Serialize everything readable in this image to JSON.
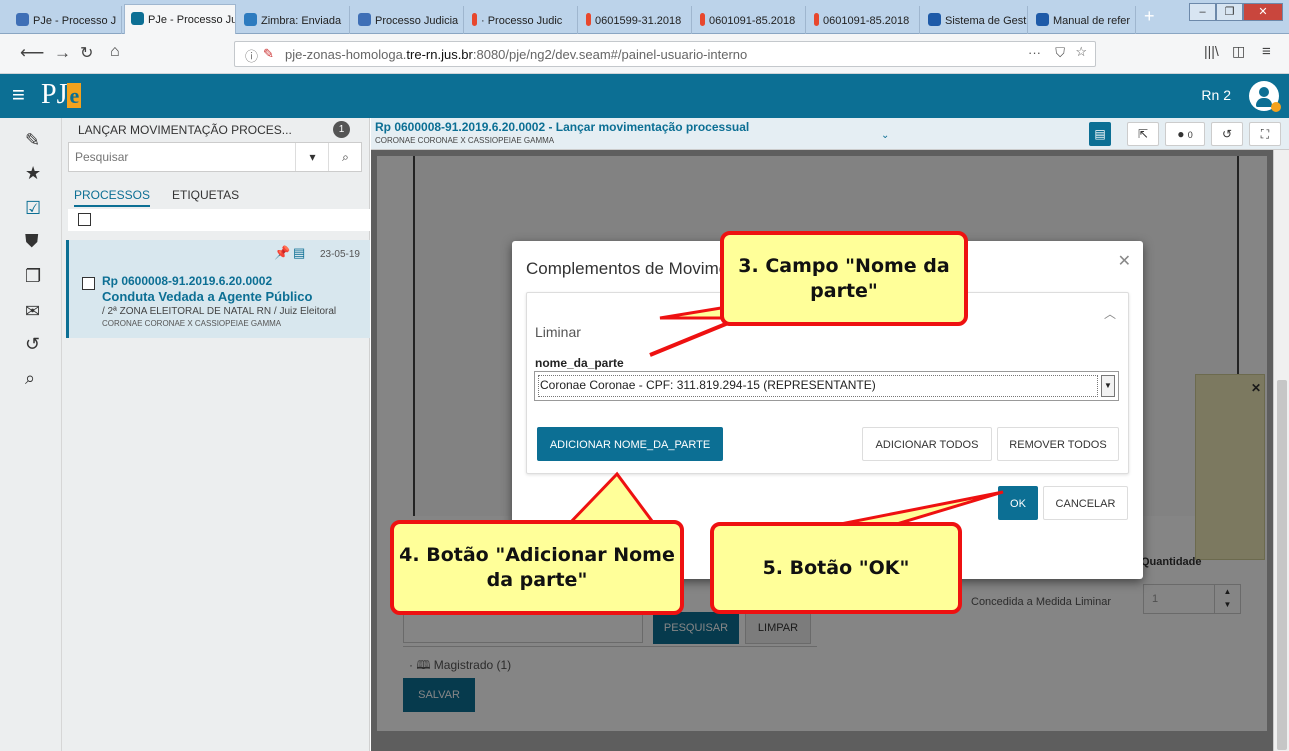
{
  "browser": {
    "tabs": [
      {
        "label": "PJe - Processo J",
        "active": false,
        "color": "#3f6fb6"
      },
      {
        "label": "PJe - Processo Ju",
        "active": true,
        "color": "#0c6f94"
      },
      {
        "label": "Zimbra: Enviada",
        "active": false,
        "color": "#2d7bbf"
      },
      {
        "label": "Processo Judicia",
        "active": false,
        "color": "#3f6fb6"
      },
      {
        "label": "· Processo Judic",
        "active": false,
        "color": "#e8472d"
      },
      {
        "label": "0601599-31.2018",
        "active": false,
        "color": "#e8472d"
      },
      {
        "label": "0601091-85.2018",
        "active": false,
        "color": "#e8472d"
      },
      {
        "label": "0601091-85.2018",
        "active": false,
        "color": "#e8472d"
      },
      {
        "label": "Sistema de Gest",
        "active": false,
        "color": "#1e5aa8"
      },
      {
        "label": "Manual de refer",
        "active": false,
        "color": "#1e5aa8"
      }
    ],
    "url_prefix": "pje-zonas-homologa.",
    "url_host": "tre-rn.jus.br",
    "url_rest": ":8080/pje/ng2/dev.seam#/painel-usuario-interno",
    "url_more": "···"
  },
  "app": {
    "logo_text": "PJ",
    "logo_e": "e",
    "user_name": "Rn 2",
    "brand_color": "#0c6f94",
    "accent_color": "#f4a21d"
  },
  "tasks": {
    "title": "LANÇAR MOVIMENTAÇÃO PROCES...",
    "count": "1",
    "search_placeholder": "Pesquisar",
    "tab_processos": "PROCESSOS",
    "tab_etiquetas": "ETIQUETAS",
    "card": {
      "date": "23-05-19",
      "number": "Rp 0600008-91.2019.6.20.0002",
      "classe": "Conduta Vedada a Agente Público",
      "orgao": "/ 2ª ZONA ELEITORAL DE NATAL RN / Juiz Eleitoral",
      "partes": "CORONAE CORONAE X CASSIOPEIAE GAMMA"
    }
  },
  "main": {
    "title": "Rp 0600008-91.2019.6.20.0002 - Lançar movimentação processual",
    "subtitle": "CORONAE CORONAE X CASSIOPEIAE GAMMA",
    "tags_count": "0",
    "bg": {
      "quantidade_label": "Quantidade",
      "medida_label": "Concedida a Medida Liminar",
      "quantidade_value": "1",
      "pesquisar": "PESQUISAR",
      "limpar": "LIMPAR",
      "magistrado": "· 🕮 Magistrado (1)",
      "salvar": "SALVAR"
    }
  },
  "modal": {
    "title": "Complementos de Movimento",
    "section": "Liminar",
    "field_label": "nome_da_parte",
    "selected_value": "Coronae Coronae - CPF: 311.819.294-15 (REPRESENTANTE)",
    "btn_add_nome": "ADICIONAR NOME_DA_PARTE",
    "btn_add_todos": "ADICIONAR TODOS",
    "btn_remover_todos": "REMOVER TODOS",
    "btn_ok": "OK",
    "btn_cancelar": "CANCELAR"
  },
  "callouts": {
    "c3": "3. Campo \"Nome da parte\"",
    "c4": "4. Botão \"Adicionar Nome da parte\"",
    "c5": "5. Botão \"OK\""
  },
  "icons": [
    "pencil-icon",
    "star-icon",
    "checkbox-icon",
    "tags-icon",
    "copy-icon",
    "envelope-icon",
    "history-icon",
    "search-icon",
    "pin-icon",
    "note-icon",
    "share-icon",
    "tag-icon",
    "fullscreen-icon"
  ]
}
